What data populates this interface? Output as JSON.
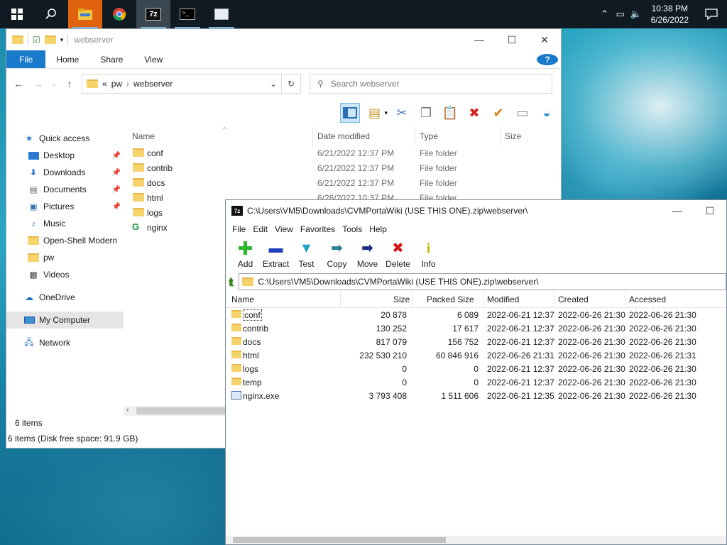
{
  "taskbar": {
    "apps": [
      "start",
      "search",
      "file-explorer",
      "chrome",
      "7-zip",
      "terminal",
      "control-panel"
    ],
    "clock": {
      "time": "10:38 PM",
      "date": "6/26/2022"
    },
    "tray_icons": [
      "chevron-up-icon",
      "network-icon",
      "volume-icon"
    ]
  },
  "explorer": {
    "title": "webserver",
    "ribbon_tabs": [
      "File",
      "Home",
      "Share",
      "View"
    ],
    "address": {
      "crumb1": "pw",
      "crumb2": "webserver",
      "prefix": "«"
    },
    "search_placeholder": "Search webserver",
    "nav": {
      "quick_access": "Quick access",
      "items": [
        "Desktop",
        "Downloads",
        "Documents",
        "Pictures",
        "Music",
        "Open-Shell Modern",
        "pw",
        "Videos"
      ],
      "onedrive": "OneDrive",
      "my_computer": "My Computer",
      "network": "Network"
    },
    "columns": {
      "name": "Name",
      "date": "Date modified",
      "type": "Type",
      "size": "Size"
    },
    "files": [
      {
        "name": "conf",
        "date": "6/21/2022 12:37 PM",
        "type": "File folder"
      },
      {
        "name": "contrib",
        "date": "6/21/2022 12:37 PM",
        "type": "File folder"
      },
      {
        "name": "docs",
        "date": "6/21/2022 12:37 PM",
        "type": "File folder"
      },
      {
        "name": "html",
        "date": "6/26/2022 10:37 PM",
        "type": "File folder"
      },
      {
        "name": "logs",
        "date": "",
        "type": ""
      },
      {
        "name": "nginx",
        "date": "",
        "type": ""
      }
    ],
    "status": {
      "items": "6 items",
      "disk": "6 items (Disk free space: 91.9 GB)"
    }
  },
  "zip": {
    "title": "C:\\Users\\VM5\\Downloads\\CVMPortaWiki (USE THIS ONE).zip\\webserver\\",
    "menu": [
      "File",
      "Edit",
      "View",
      "Favorites",
      "Tools",
      "Help"
    ],
    "tools": [
      {
        "label": "Add",
        "icon": "+",
        "color": "#2bb52b"
      },
      {
        "label": "Extract",
        "icon": "▬",
        "color": "#1f3fbf"
      },
      {
        "label": "Test",
        "icon": "▼",
        "color": "#25a6c8"
      },
      {
        "label": "Copy",
        "icon": "➡",
        "color": "#2a7f8f"
      },
      {
        "label": "Move",
        "icon": "➡",
        "color": "#1a2a8a"
      },
      {
        "label": "Delete",
        "icon": "✖",
        "color": "#d41a1a"
      },
      {
        "label": "Info",
        "icon": "i",
        "color": "#c8b400"
      }
    ],
    "address": "C:\\Users\\VM5\\Downloads\\CVMPortaWiki (USE THIS ONE).zip\\webserver\\",
    "columns": {
      "name": "Name",
      "size": "Size",
      "packed": "Packed Size",
      "modified": "Modified",
      "created": "Created",
      "accessed": "Accessed"
    },
    "rows": [
      {
        "name": "conf",
        "size": "20 878",
        "packed": "6 089",
        "modified": "2022-06-21 12:37",
        "created": "2022-06-26 21:30",
        "accessed": "2022-06-26 21:30",
        "kind": "folder"
      },
      {
        "name": "contrib",
        "size": "130 252",
        "packed": "17 617",
        "modified": "2022-06-21 12:37",
        "created": "2022-06-26 21:30",
        "accessed": "2022-06-26 21:30",
        "kind": "folder"
      },
      {
        "name": "docs",
        "size": "817 079",
        "packed": "156 752",
        "modified": "2022-06-21 12:37",
        "created": "2022-06-26 21:30",
        "accessed": "2022-06-26 21:30",
        "kind": "folder"
      },
      {
        "name": "html",
        "size": "232 530 210",
        "packed": "60 846 916",
        "modified": "2022-06-26 21:31",
        "created": "2022-06-26 21:30",
        "accessed": "2022-06-26 21:31",
        "kind": "folder"
      },
      {
        "name": "logs",
        "size": "0",
        "packed": "0",
        "modified": "2022-06-21 12:37",
        "created": "2022-06-26 21:30",
        "accessed": "2022-06-26 21:30",
        "kind": "folder"
      },
      {
        "name": "temp",
        "size": "0",
        "packed": "0",
        "modified": "2022-06-21 12:37",
        "created": "2022-06-26 21:30",
        "accessed": "2022-06-26 21:30",
        "kind": "folder"
      },
      {
        "name": "nginx.exe",
        "size": "3 793 408",
        "packed": "1 511 606",
        "modified": "2022-06-21 12:35",
        "created": "2022-06-26 21:30",
        "accessed": "2022-06-26 21:30",
        "kind": "exe"
      }
    ]
  }
}
